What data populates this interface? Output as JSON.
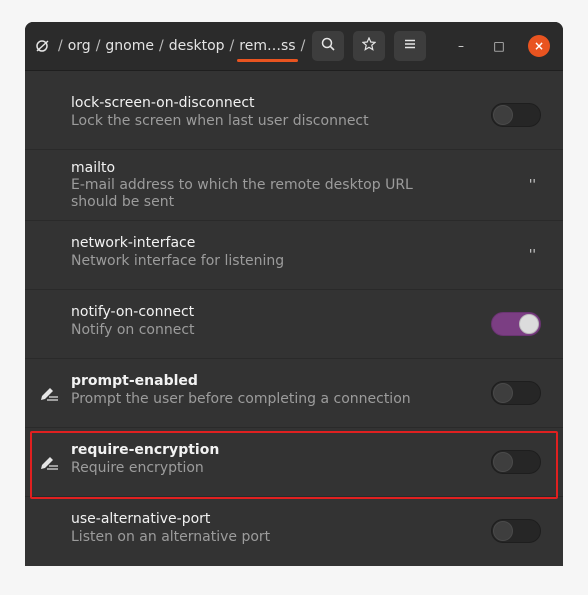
{
  "header": {
    "path": [
      {
        "label": "org"
      },
      {
        "label": "gnome"
      },
      {
        "label": "desktop"
      },
      {
        "label": "rem…ss"
      }
    ],
    "separator": "/",
    "search_icon": "search-icon",
    "bookmark_icon": "star-icon",
    "menu_icon": "hamburger-menu-icon",
    "minimize": "–",
    "maximize": "□",
    "close": "×"
  },
  "keys": [
    {
      "name": "lock-screen-on-disconnect",
      "description": "Lock the screen when last user disconnect",
      "type": "toggle",
      "on": false,
      "modified": false
    },
    {
      "name": "mailto",
      "description": "E-mail address to which the remote desktop URL should be sent",
      "type": "text",
      "value": "''",
      "modified": false
    },
    {
      "name": "network-interface",
      "description": "Network interface for listening",
      "type": "text",
      "value": "''",
      "modified": false
    },
    {
      "name": "notify-on-connect",
      "description": "Notify on connect",
      "type": "toggle",
      "on": true,
      "modified": false
    },
    {
      "name": "prompt-enabled",
      "description": "Prompt the user before completing a connection",
      "type": "toggle",
      "on": false,
      "modified": true
    },
    {
      "name": "require-encryption",
      "description": "Require encryption",
      "type": "toggle",
      "on": false,
      "modified": true
    },
    {
      "name": "use-alternative-port",
      "description": "Listen on an alternative port",
      "type": "toggle",
      "on": false,
      "modified": false
    }
  ],
  "colors": {
    "accent": "#e95420",
    "toggle_on": "#7b3e83",
    "highlight": "#e02020"
  }
}
